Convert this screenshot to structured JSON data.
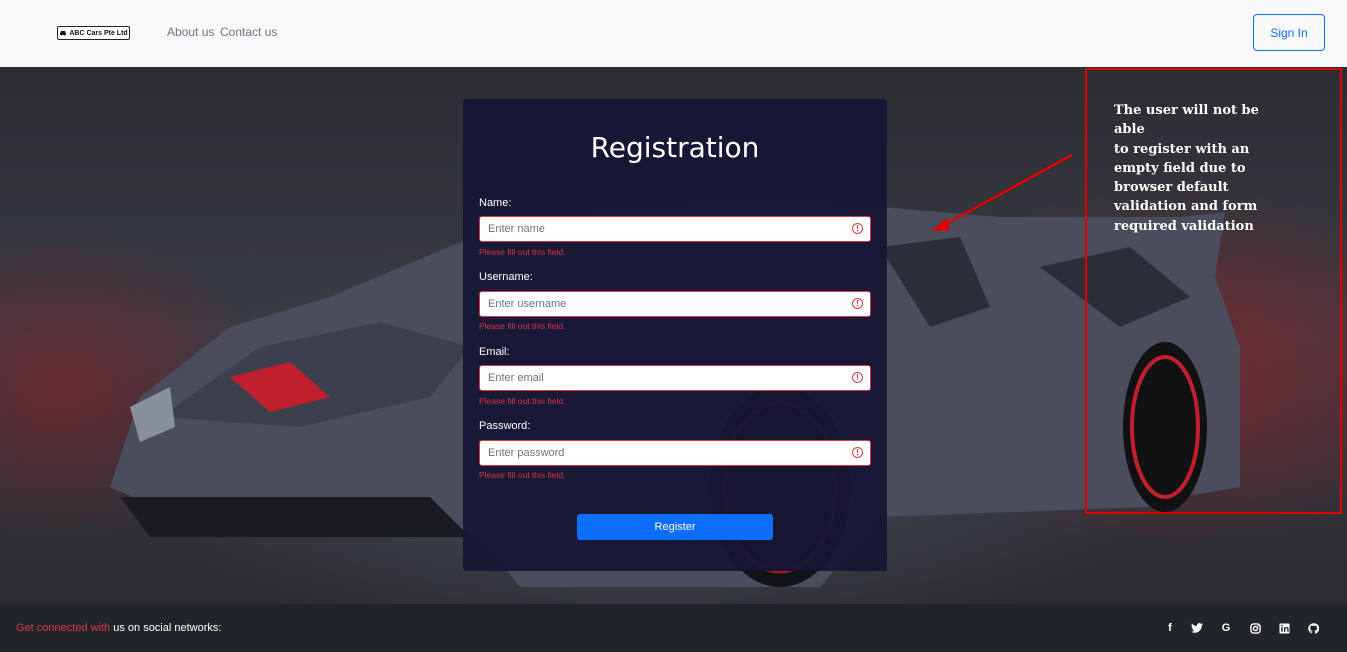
{
  "navbar": {
    "brand": "ABC Cars Pte Ltd",
    "links": [
      "About us",
      "Contact us"
    ],
    "signin_label": "Sign In"
  },
  "form": {
    "title": "Registration",
    "fields": [
      {
        "label": "Name:",
        "placeholder": "Enter name",
        "error": "Please fill out this field."
      },
      {
        "label": "Username:",
        "placeholder": "Enter username",
        "error": "Please fill out this field."
      },
      {
        "label": "Email:",
        "placeholder": "Enter email",
        "error": "Please fill out this field."
      },
      {
        "label": "Password:",
        "placeholder": "Enter password",
        "error": "Please fill out this field."
      }
    ],
    "submit_label": "Register"
  },
  "annotation": {
    "lines": [
      "The user will not be able",
      "to register with an",
      "empty field due to",
      "browser default",
      "validation and form",
      "required validation"
    ],
    "color": "#e00000"
  },
  "footer": {
    "accent_text": "Get connected with",
    "text": " us on social networks:",
    "social_icons": [
      "facebook-icon",
      "twitter-icon",
      "google-icon",
      "instagram-icon",
      "linkedin-icon",
      "github-icon"
    ]
  },
  "colors": {
    "primary": "#0d6efd",
    "danger": "#dc3545",
    "card_bg": "#14163a",
    "footer_bg": "#212529"
  }
}
